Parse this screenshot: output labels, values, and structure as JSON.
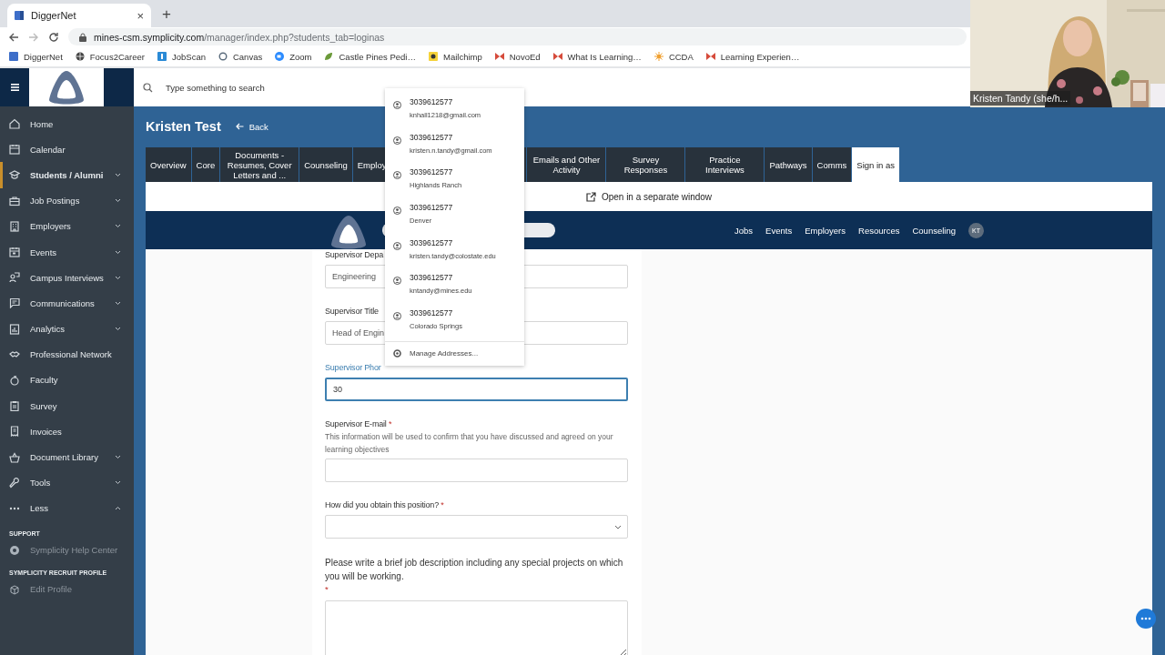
{
  "browser": {
    "tab": {
      "title": "DiggerNet",
      "close": "×",
      "selected": true
    },
    "new_tab": "+",
    "address": {
      "host": "mines-csm.symplicity.com",
      "path": "/manager/index.php?students_tab=loginas"
    },
    "bookmarks": [
      {
        "label": "DiggerNet"
      },
      {
        "label": "Focus2Career"
      },
      {
        "label": "JobScan"
      },
      {
        "label": "Canvas"
      },
      {
        "label": "Zoom"
      },
      {
        "label": "Castle Pines Pedi…"
      },
      {
        "label": "Mailchimp"
      },
      {
        "label": "NovoEd"
      },
      {
        "label": "What Is Learning…"
      },
      {
        "label": "CCDA"
      },
      {
        "label": "Learning Experien…"
      }
    ]
  },
  "video_tile": {
    "kind": "picture",
    "caption": "Kristen Tandy (she/h..."
  },
  "app_header": {
    "search_placeholder": "Type something to search"
  },
  "sidebar": {
    "items": [
      {
        "label": "Home",
        "kind": "link",
        "selected": false
      },
      {
        "label": "Calendar",
        "kind": "link",
        "selected": false
      },
      {
        "label": "Students / Alumni",
        "kind": "menu",
        "selected": true,
        "expanded": false
      },
      {
        "label": "Job Postings",
        "kind": "menu",
        "selected": false,
        "expanded": false
      },
      {
        "label": "Employers",
        "kind": "menu",
        "selected": false,
        "expanded": false
      },
      {
        "label": "Events",
        "kind": "menu",
        "selected": false,
        "expanded": false
      },
      {
        "label": "Campus Interviews",
        "kind": "menu",
        "selected": false,
        "expanded": false
      },
      {
        "label": "Communications",
        "kind": "menu",
        "selected": false,
        "expanded": false
      },
      {
        "label": "Analytics",
        "kind": "menu",
        "selected": false,
        "expanded": false
      },
      {
        "label": "Professional Network",
        "kind": "link",
        "selected": false
      },
      {
        "label": "Faculty",
        "kind": "link",
        "selected": false
      },
      {
        "label": "Survey",
        "kind": "link",
        "selected": false
      },
      {
        "label": "Invoices",
        "kind": "link",
        "selected": false
      },
      {
        "label": "Document Library",
        "kind": "menu",
        "selected": false,
        "expanded": false
      },
      {
        "label": "Tools",
        "kind": "menu",
        "selected": false,
        "expanded": false
      },
      {
        "label": "Less",
        "kind": "menu",
        "selected": false,
        "expanded": true
      }
    ],
    "sections": [
      {
        "title": "SUPPORT",
        "items": [
          {
            "label": "Symplicity Help Center"
          }
        ]
      },
      {
        "title": "SYMPLICITY RECRUIT PROFILE",
        "items": [
          {
            "label": "Edit Profile"
          }
        ]
      }
    ]
  },
  "page": {
    "title": "Kristen Test",
    "back": "Back",
    "tabs": [
      {
        "label": "Overview",
        "selected": false
      },
      {
        "label": "Core",
        "selected": false
      },
      {
        "label": "Documents - Resumes, Cover Letters and ...",
        "selected": false
      },
      {
        "label": "Counseling",
        "selected": false
      },
      {
        "label": "Employ",
        "selected": false,
        "kind": "covered"
      },
      {
        "label": "Emails and Other Activity",
        "selected": false
      },
      {
        "label": "Survey Responses",
        "selected": false
      },
      {
        "label": "Practice Interviews",
        "selected": false
      },
      {
        "label": "Pathways",
        "selected": false
      },
      {
        "label": "Comms",
        "selected": false
      },
      {
        "label": "Sign in as",
        "selected": true
      }
    ],
    "open_window": "Open in a separate window"
  },
  "embedded_nav": {
    "links": [
      "Jobs",
      "Events",
      "Employers",
      "Resources",
      "Counseling"
    ],
    "avatar": "KT"
  },
  "form": {
    "fields": [
      {
        "kind": "input",
        "label": "Supervisor Depa",
        "value": "Engineering",
        "focused": false
      },
      {
        "kind": "input",
        "label": "Supervisor Title",
        "value": "Head of Engin",
        "focused": false
      },
      {
        "kind": "input",
        "label": "Supervisor Phor",
        "value": "30",
        "focused": true
      },
      {
        "kind": "input",
        "label": "Supervisor E-mail",
        "required": "*",
        "help": "This information will be used to confirm that you have discussed and agreed on your learning objectives",
        "focused": false
      },
      {
        "kind": "select",
        "label": "How did you obtain this position?",
        "required": "*",
        "focused": false
      },
      {
        "kind": "textarea",
        "label": "Please write a brief job description including any special projects on which you will be working.",
        "required": "*",
        "focused": false
      }
    ]
  },
  "autocomplete": {
    "items": [
      {
        "title": "3039612577",
        "detail": "knhall1218@gmail.com"
      },
      {
        "title": "3039612577",
        "detail": "kristen.n.tandy@gmail.com"
      },
      {
        "title": "3039612577",
        "detail": "Highlands Ranch"
      },
      {
        "title": "3039612577",
        "detail": "Denver"
      },
      {
        "title": "3039612577",
        "detail": "kristen.tandy@colostate.edu"
      },
      {
        "title": "3039612577",
        "detail": "kntandy@mines.edu"
      },
      {
        "title": "3039612577",
        "detail": "Colorado Springs"
      }
    ],
    "footer": "Manage Addresses..."
  }
}
